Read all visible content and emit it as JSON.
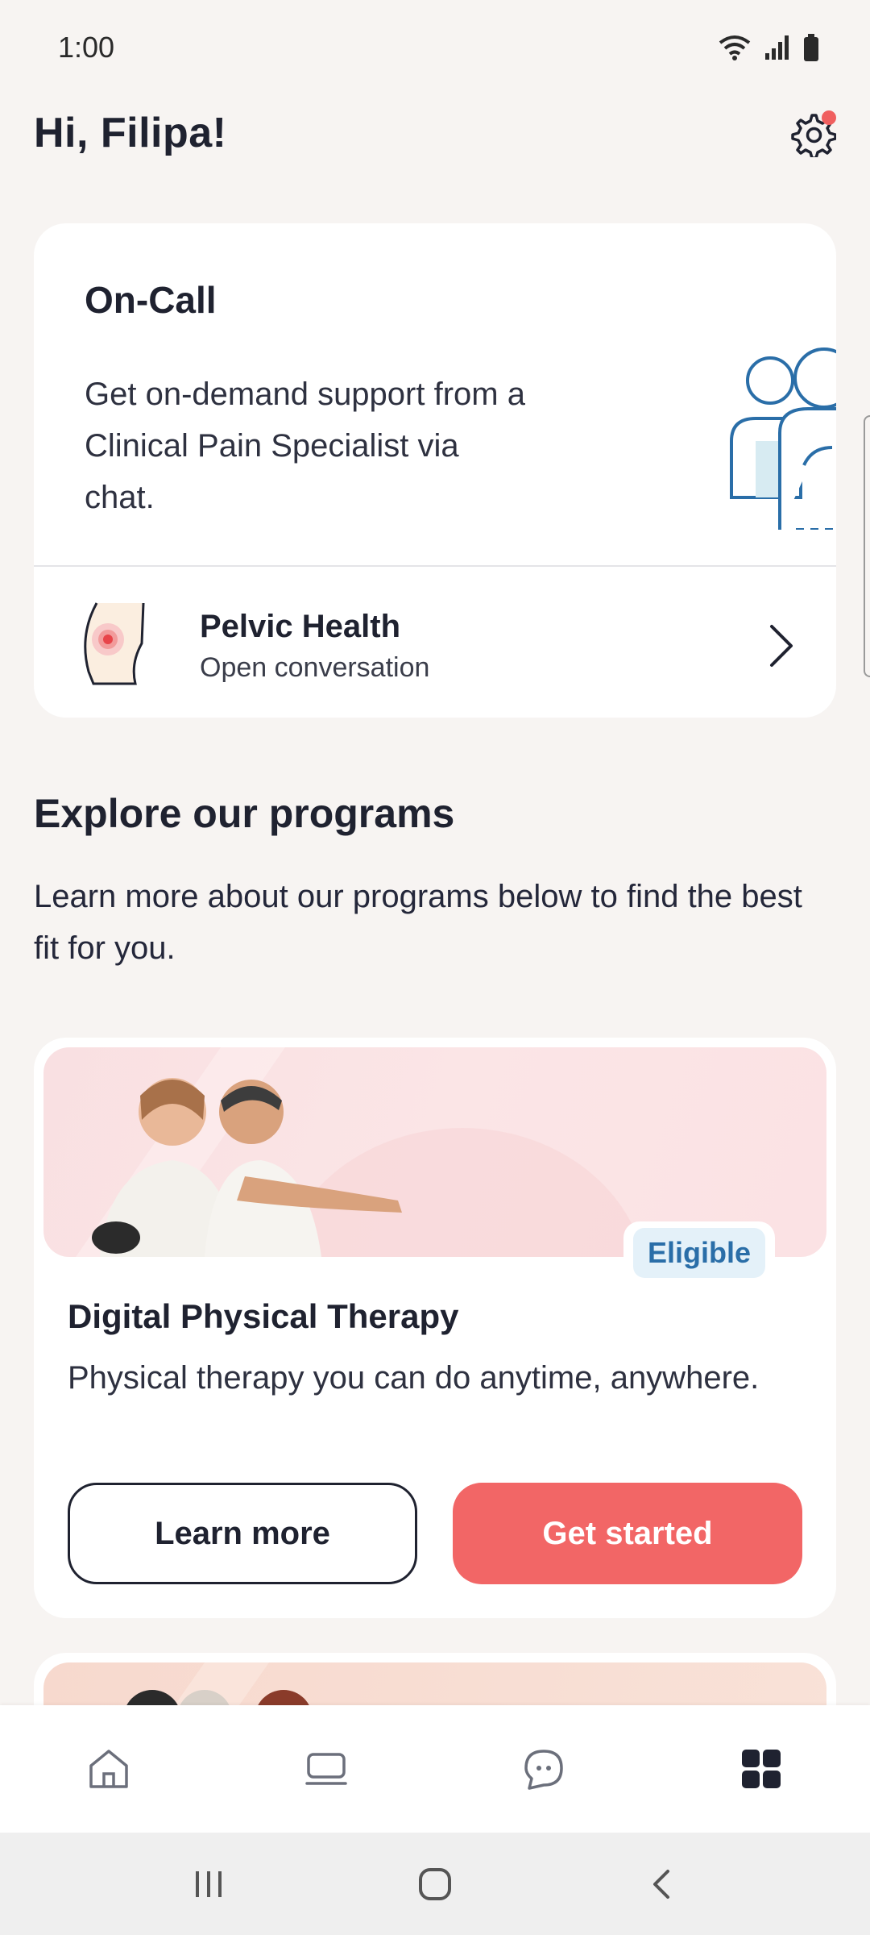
{
  "status_bar": {
    "time": "1:00"
  },
  "header": {
    "greeting": "Hi, Filipa!"
  },
  "oncall": {
    "title": "On-Call",
    "description": "Get on-demand support from a Clinical Pain Specialist via chat.",
    "conversation": {
      "title": "Pelvic Health",
      "subtitle": "Open conversation"
    }
  },
  "explore": {
    "title": "Explore our programs",
    "description": "Learn more about our programs below to find the best fit for you."
  },
  "program": {
    "badge": "Eligible",
    "title": "Digital Physical Therapy",
    "description": "Physical therapy you can do anytime, anywhere.",
    "learn_more_label": "Learn more",
    "get_started_label": "Get started"
  },
  "bottom_nav": {
    "items": [
      {
        "icon": "home-icon"
      },
      {
        "icon": "laptop-icon"
      },
      {
        "icon": "chat-icon"
      },
      {
        "icon": "grid-icon",
        "active": true
      }
    ]
  },
  "colors": {
    "accent": "#f26666",
    "badge_text": "#2a6ea8",
    "badge_bg": "#e4f1f9",
    "background": "#f7f4f2"
  }
}
